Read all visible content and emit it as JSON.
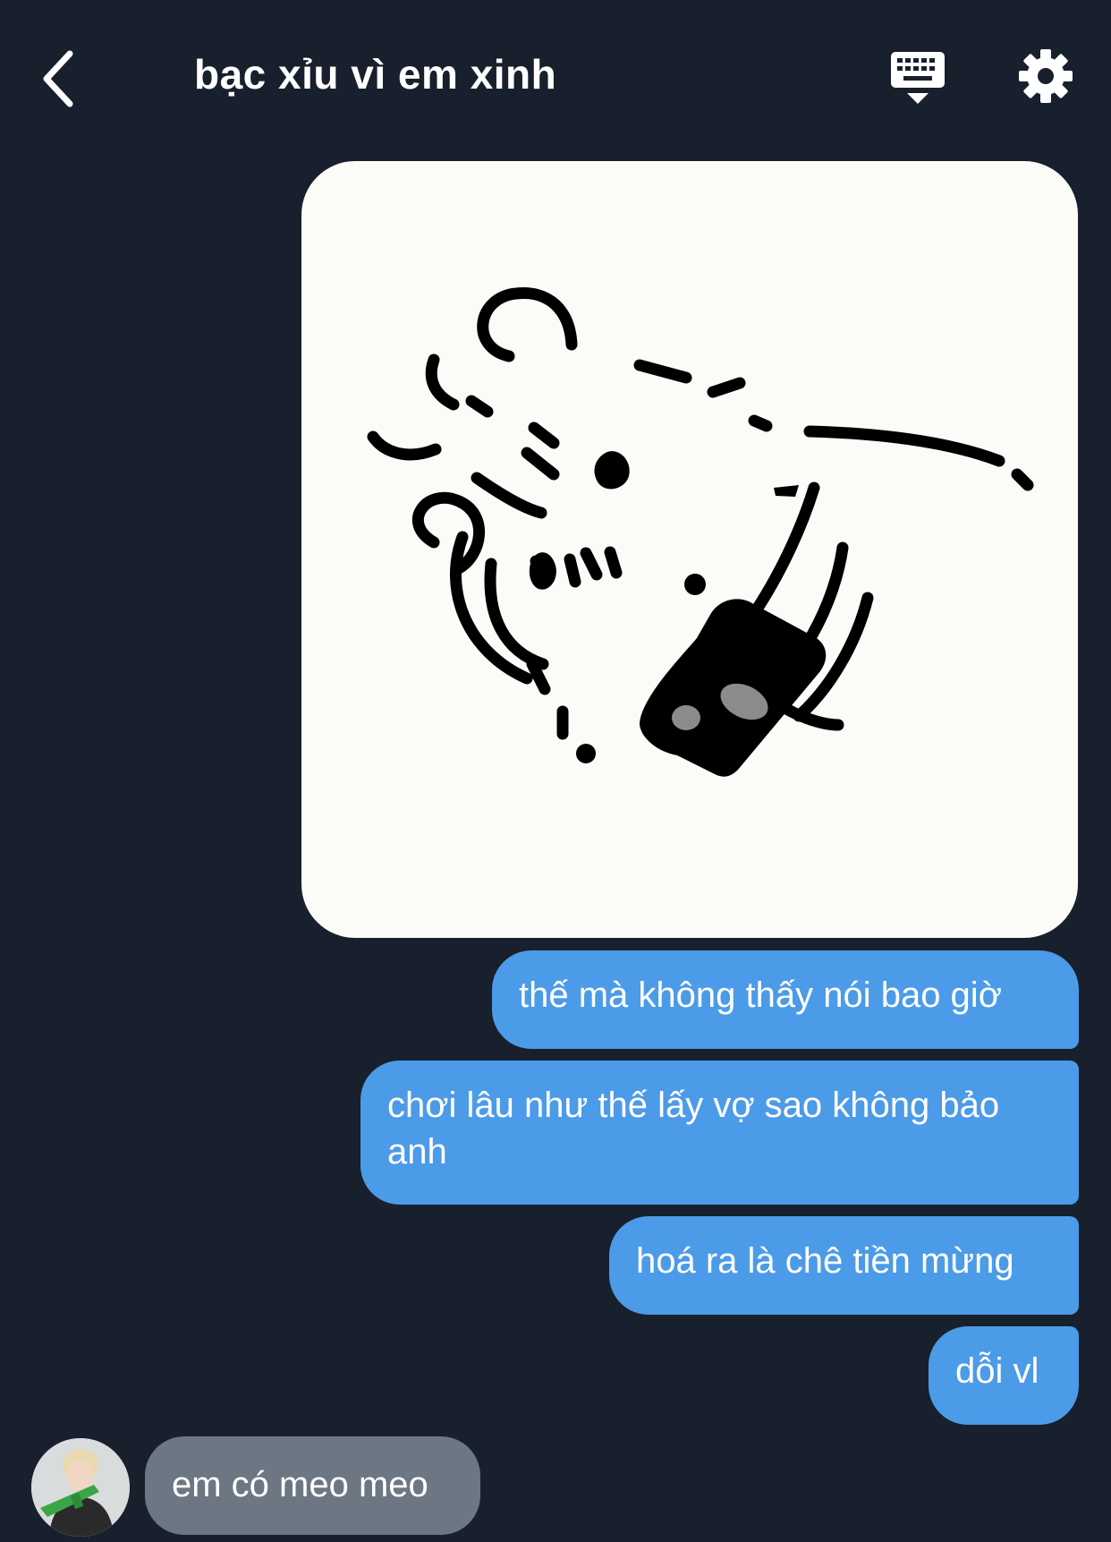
{
  "header": {
    "title": "bạc xỉu vì em xinh",
    "back_icon": "chevron-left-icon",
    "keyboard_icon": "keyboard-icon",
    "settings_icon": "gear-icon"
  },
  "messages": {
    "sticker": "mouse-sticker",
    "sent": [
      "thế mà không thấy nói bao giờ",
      "chơi lâu như thế lấy vợ sao không bảo anh",
      "hoá ra là chê tiền mừng",
      "dỗi vl"
    ],
    "received": {
      "text": "em có meo meo"
    }
  },
  "colors": {
    "background": "#18202d",
    "sent_bubble": "#4c9be8",
    "received_bubble": "#6c7783",
    "text": "#ffffff"
  }
}
